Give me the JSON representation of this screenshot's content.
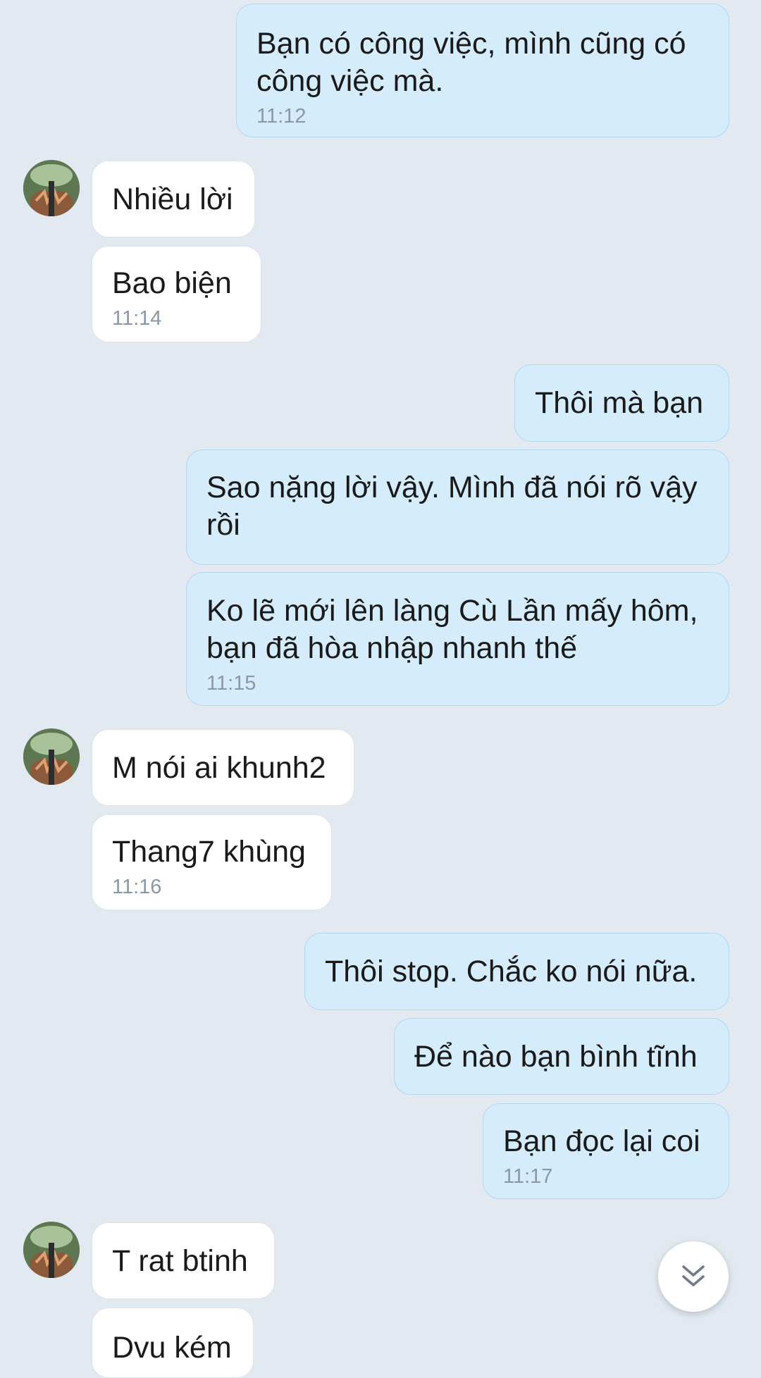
{
  "messages": [
    {
      "dir": "out",
      "text": "Bạn có công việc, mình cũng có\ncông việc mà.",
      "time": "11:12"
    },
    {
      "dir": "in",
      "text": "Nhiều lời"
    },
    {
      "dir": "in",
      "text": "Bao biện",
      "time": "11:14"
    },
    {
      "dir": "out",
      "text": "Thôi mà bạn"
    },
    {
      "dir": "out",
      "text": "Sao nặng lời vậy. Mình đã nói rõ vậy\nrồi"
    },
    {
      "dir": "out",
      "text": "Ko lẽ mới lên làng Cù Lần mấy hôm,\nbạn đã hòa nhập nhanh thế",
      "time": "11:15"
    },
    {
      "dir": "in",
      "text": "M nói ai khunh2"
    },
    {
      "dir": "in",
      "text": "Thang7 khùng",
      "time": "11:16"
    },
    {
      "dir": "out",
      "text": "Thôi stop. Chắc ko nói nữa."
    },
    {
      "dir": "out",
      "text": "Để nào bạn bình tĩnh"
    },
    {
      "dir": "out",
      "text": "Bạn đọc lại coi",
      "time": "11:17"
    },
    {
      "dir": "in",
      "text": "T rat btinh"
    },
    {
      "dir": "in",
      "text": "Dvu kém"
    }
  ],
  "avatar_icon": "contact-avatar-icon",
  "scroll_button_icon": "double-chevron-down-icon"
}
